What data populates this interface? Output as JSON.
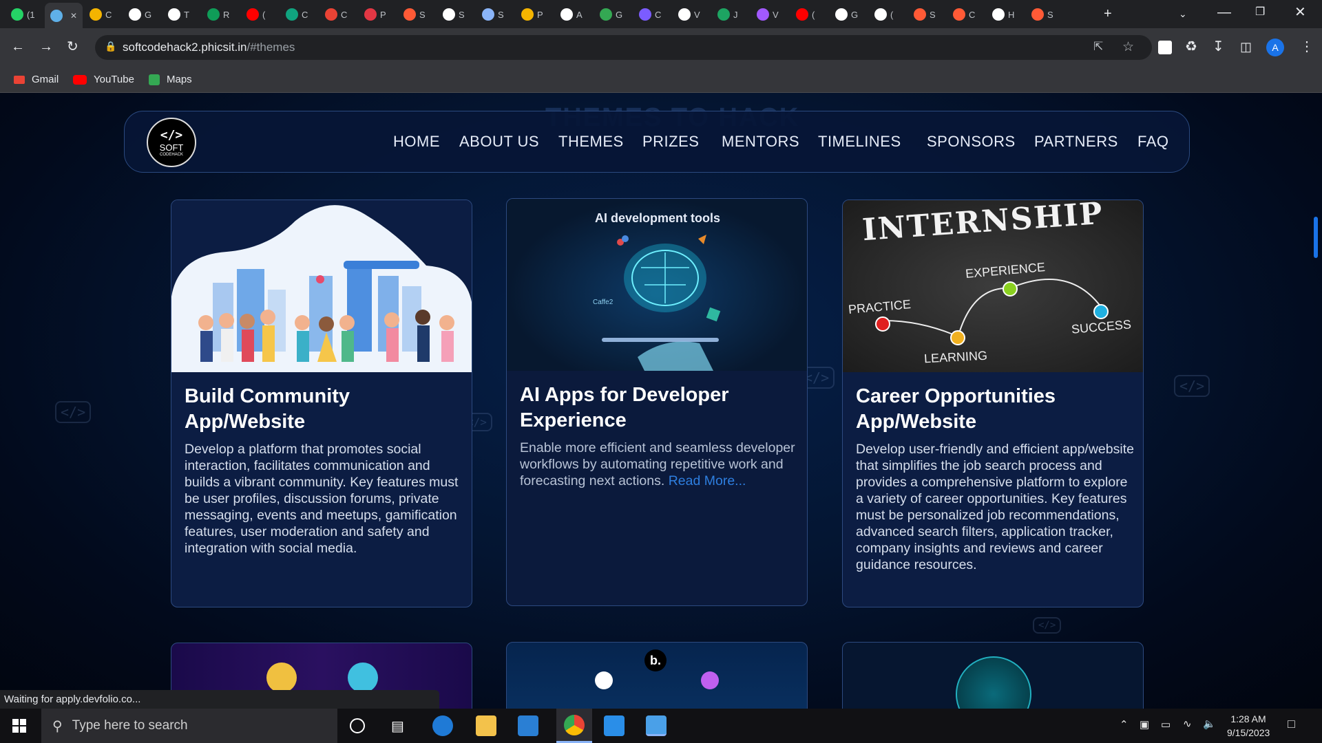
{
  "browser": {
    "tabs": [
      {
        "label": "(1",
        "color": "#25d366"
      },
      {
        "label": "",
        "color": "#5fb0e8",
        "active": true
      },
      {
        "label": "C",
        "color": "#f4b400"
      },
      {
        "label": "G",
        "color": "#ffffff"
      },
      {
        "label": "T",
        "color": "#ffffff"
      },
      {
        "label": "R",
        "color": "#0f9d58"
      },
      {
        "label": "(",
        "color": "#ff0000"
      },
      {
        "label": "C",
        "color": "#10a37f"
      },
      {
        "label": "C",
        "color": "#ea4335"
      },
      {
        "label": "P",
        "color": "#e23744"
      },
      {
        "label": "S",
        "color": "#ff5a36"
      },
      {
        "label": "S",
        "color": "#ffffff"
      },
      {
        "label": "S",
        "color": "#8ab4f8"
      },
      {
        "label": "P",
        "color": "#f4b400"
      },
      {
        "label": "A",
        "color": "#ffffff"
      },
      {
        "label": "G",
        "color": "#34a853"
      },
      {
        "label": "C",
        "color": "#7b5cff"
      },
      {
        "label": "V",
        "color": "#ffffff"
      },
      {
        "label": "J",
        "color": "#1da462"
      },
      {
        "label": "V",
        "color": "#a259ff"
      },
      {
        "label": "(",
        "color": "#ff0000"
      },
      {
        "label": "G",
        "color": "#ffffff"
      },
      {
        "label": "(",
        "color": "#ffffff"
      },
      {
        "label": "S",
        "color": "#ff5a36"
      },
      {
        "label": "C",
        "color": "#ff5a36"
      },
      {
        "label": "H",
        "color": "#ffffff"
      },
      {
        "label": "S",
        "color": "#ff5a36"
      }
    ],
    "new_tab": "+",
    "url_domain": "softcodehack2.phicsit.in",
    "url_path": "/#themes",
    "profile_initial": "A",
    "bookmarks": [
      {
        "label": "Gmail",
        "color": "#ea4335"
      },
      {
        "label": "YouTube",
        "color": "#ff0000"
      },
      {
        "label": "Maps",
        "color": "#34a853"
      }
    ],
    "status_text": "Waiting for apply.devfolio.co..."
  },
  "page": {
    "logo": {
      "line1": "</>",
      "line2": "SOFT",
      "line3": "CODEHACK"
    },
    "ghost_title": "THEMES TO HACK",
    "nav": [
      "HOME",
      "ABOUT US",
      "THEMES",
      "PRIZES",
      "MENTORS",
      "TIMELINES",
      "SPONSORS",
      "PARTNERS",
      "FAQ"
    ],
    "cards": [
      {
        "title_line1": "Build Community",
        "title_line2": "App/Website",
        "description": "Develop a platform that promotes social interaction, facilitates communication and builds a vibrant community. Key features must be user profiles, discussion forums, private messaging, events and meetups, gamification features, user moderation and safety and integration with social media."
      },
      {
        "title_line1": "AI Apps for Developer",
        "title_line2": "Experience",
        "image_caption": "AI development tools",
        "image_label": "Caffe2",
        "description": "Enable more efficient and seamless developer workflows by automating repetitive work and forecasting next actions.",
        "read_more": "Read More..."
      },
      {
        "title_line1": "Career Opportunities",
        "title_line2": "App/Website",
        "image_heading": "INTERNSHIP",
        "image_words": [
          "PRACTICE",
          "EXPERIENCE",
          "LEARNING",
          "SUCCESS"
        ],
        "description": "Develop user-friendly and efficient app/website that simplifies the job search process and provides a comprehensive platform to explore a variety of career opportunities. Key features must be personalized job recommendations, advanced search filters, application tracker, company insights and reviews and career guidance resources."
      }
    ],
    "bottom_card_mark": "b."
  },
  "taskbar": {
    "search_placeholder": "Type here to search",
    "time": "1:28 AM",
    "date": "9/15/2023"
  }
}
